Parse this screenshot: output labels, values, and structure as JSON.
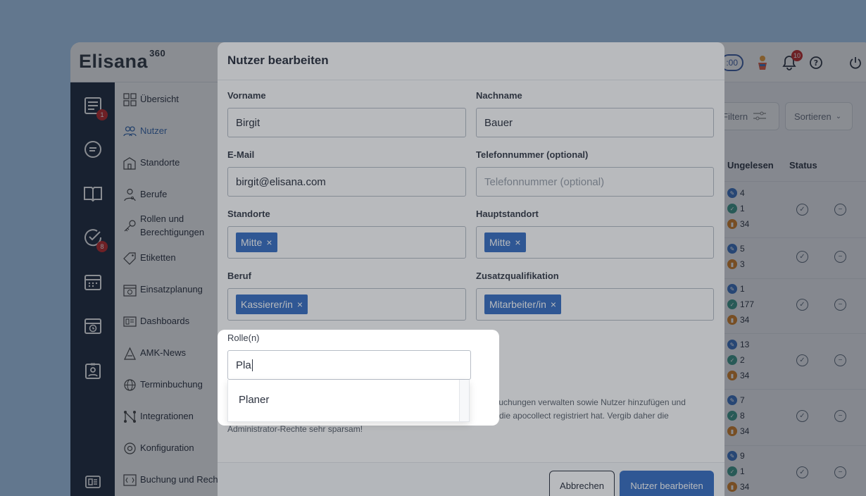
{
  "app": {
    "logo": "Elisana",
    "logo_sup": "360"
  },
  "topbar": {
    "time_pill": ":00",
    "notifications_count": "10"
  },
  "rail": {
    "news_badge": "1",
    "tasks_badge": "8"
  },
  "nav": {
    "items": [
      {
        "label": "Übersicht",
        "icon": "overview-icon"
      },
      {
        "label": "Nutzer",
        "icon": "users-icon",
        "active": true
      },
      {
        "label": "Standorte",
        "icon": "locations-icon"
      },
      {
        "label": "Berufe",
        "icon": "professions-icon"
      },
      {
        "label": "Rollen und Berechtigungen",
        "icon": "key-icon"
      },
      {
        "label": "Etiketten",
        "icon": "tag-icon"
      },
      {
        "label": "Einsatzplanung",
        "icon": "calendar-icon"
      },
      {
        "label": "Dashboards",
        "icon": "dashboard-icon"
      },
      {
        "label": "AMK-News",
        "icon": "news-icon"
      },
      {
        "label": "Terminbuchung",
        "icon": "globe-icon"
      },
      {
        "label": "Integrationen",
        "icon": "integrations-icon"
      },
      {
        "label": "Konfiguration",
        "icon": "settings-icon"
      },
      {
        "label": "Buchung und Rechn",
        "icon": "billing-icon"
      }
    ]
  },
  "main": {
    "filter_label": "Filtern",
    "sort_label": "Sortieren",
    "col_unread": "Ungelesen",
    "col_status": "Status",
    "rows": [
      {
        "counts": [
          "4",
          "1",
          "34"
        ]
      },
      {
        "counts": [
          "5",
          "3"
        ]
      },
      {
        "counts": [
          "1",
          "177",
          "34"
        ]
      },
      {
        "counts": [
          "13",
          "2",
          "34"
        ]
      },
      {
        "counts": [
          "7",
          "8",
          "34"
        ]
      },
      {
        "counts": [
          "9",
          "1",
          "34"
        ]
      }
    ]
  },
  "modal": {
    "title": "Nutzer bearbeiten",
    "first_name_label": "Vorname",
    "first_name_value": "Birgit",
    "last_name_label": "Nachname",
    "last_name_value": "Bauer",
    "email_label": "E-Mail",
    "email_value": "birgit@elisana.com",
    "phone_label": "Telefonnummer (optional)",
    "phone_placeholder": "Telefonnummer (optional)",
    "locations_label": "Standorte",
    "locations_tag": "Mitte",
    "main_location_label": "Hauptstandort",
    "main_location_tag": "Mitte",
    "profession_label": "Beruf",
    "profession_tag": "Kassierer/in",
    "qualification_label": "Zusatzqualifikation",
    "qualification_tag": "Mitarbeiter/in",
    "tag_remove": "×",
    "desc_line1": "ch und Buchungen verwalten sowie Nutzer hinzufügen und",
    "desc_line2": "rson, die apocollect registriert hat. Vergib daher die",
    "desc_line3": "Administrator-Rechte sehr sparsam!",
    "cancel_label": "Abbrechen",
    "submit_label": "Nutzer bearbeiten"
  },
  "roles": {
    "label": "Rolle(n)",
    "input_value": "Pla",
    "option": "Planer"
  },
  "colors": {
    "accent": "#3b72c4",
    "rail": "#1e2a3d",
    "badge": "#c62828",
    "background": "#b0d4f7"
  }
}
